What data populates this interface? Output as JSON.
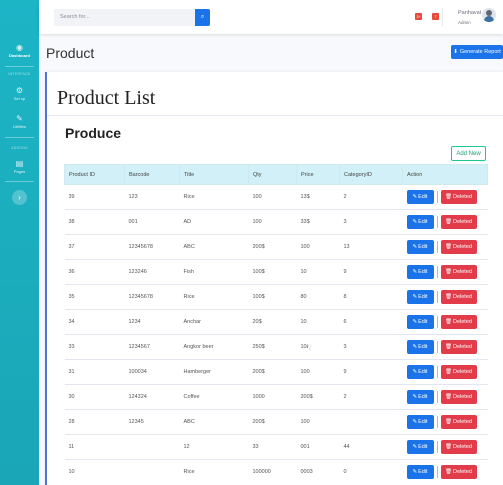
{
  "sidebar": {
    "dashboard_label": "Dashboard",
    "interface_heading": "INTERFACE",
    "setup_label": "Set up",
    "utilities_label": "Utilities",
    "addons_heading": "ADDONS",
    "pages_label": "Pages"
  },
  "topbar": {
    "search_placeholder": "Search for...",
    "alerts_count": "3+",
    "messages_count": "7",
    "user_name": "Panhavat",
    "user_role": "Admin"
  },
  "page": {
    "title": "Product",
    "generate_report_label": "Generate Report"
  },
  "card": {
    "title": "Product List",
    "section_title": "Produce",
    "add_new_label": "Add New"
  },
  "table": {
    "columns": [
      "Product ID",
      "Barcode",
      "Title",
      "Qty",
      "Price",
      "CategoryID",
      "Action"
    ],
    "edit_label": "Edit",
    "delete_label": "Deleted",
    "rows": [
      [
        "39",
        "123",
        "Rice",
        "100",
        "13$",
        "2"
      ],
      [
        "38",
        "001",
        "AD",
        "100",
        "33$",
        "3"
      ],
      [
        "37",
        "12345678",
        "ABC",
        "200$",
        "100",
        "13"
      ],
      [
        "36",
        "123246",
        "Fish",
        "100$",
        "10",
        "9"
      ],
      [
        "35",
        "12345678",
        "Rice",
        "100$",
        "80",
        "8"
      ],
      [
        "34",
        "1234",
        "Anchar",
        "20$",
        "10",
        "6"
      ],
      [
        "33",
        "1234567",
        "Angkor beer",
        "250$",
        "10៛្",
        "3"
      ],
      [
        "31",
        "100034",
        "Hamberger",
        "200$",
        "100",
        "9"
      ],
      [
        "30",
        "124324",
        "Coffee",
        "1000",
        "200$",
        "2"
      ],
      [
        "28",
        "12345",
        "ABC",
        "200$",
        "100",
        ""
      ],
      [
        "11",
        "",
        "12",
        "33",
        "001",
        "44"
      ],
      [
        "10",
        "",
        "Rice",
        "100000",
        "0003",
        "0"
      ]
    ]
  },
  "colors": {
    "sidebar": "#1cb5c6",
    "primary": "#1a73e8",
    "danger": "#e23b4a",
    "table_header": "#d2f0f7",
    "success": "#1cc88a"
  }
}
